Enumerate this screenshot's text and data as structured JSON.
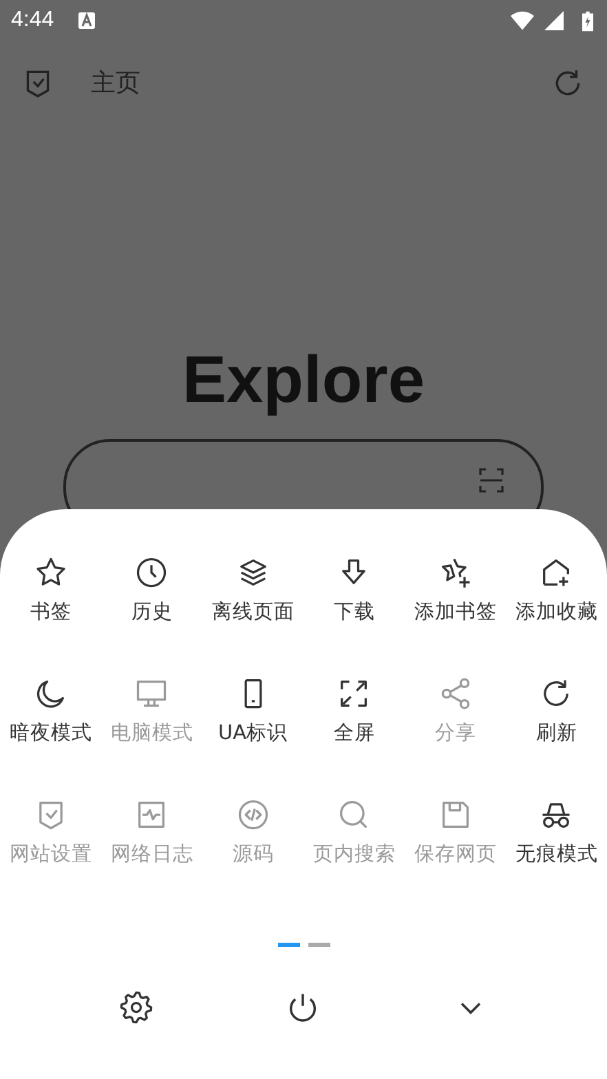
{
  "status_bar": {
    "time": "4:44"
  },
  "top_bar": {
    "title": "主页"
  },
  "heading": "Explore",
  "menu": {
    "rows": [
      [
        {
          "label": "书签",
          "disabled": false
        },
        {
          "label": "历史",
          "disabled": false
        },
        {
          "label": "离线页面",
          "disabled": false
        },
        {
          "label": "下载",
          "disabled": false
        },
        {
          "label": "添加书签",
          "disabled": false
        },
        {
          "label": "添加收藏",
          "disabled": false
        }
      ],
      [
        {
          "label": "暗夜模式",
          "disabled": false
        },
        {
          "label": "电脑模式",
          "disabled": true
        },
        {
          "label": "UA标识",
          "disabled": false
        },
        {
          "label": "全屏",
          "disabled": false
        },
        {
          "label": "分享",
          "disabled": true
        },
        {
          "label": "刷新",
          "disabled": false
        }
      ],
      [
        {
          "label": "网站设置",
          "disabled": true
        },
        {
          "label": "网络日志",
          "disabled": true
        },
        {
          "label": "源码",
          "disabled": true
        },
        {
          "label": "页内搜索",
          "disabled": true
        },
        {
          "label": "保存网页",
          "disabled": true
        },
        {
          "label": "无痕模式",
          "disabled": false
        }
      ]
    ],
    "pager": [
      {
        "selected": true
      },
      {
        "selected": false
      }
    ]
  }
}
